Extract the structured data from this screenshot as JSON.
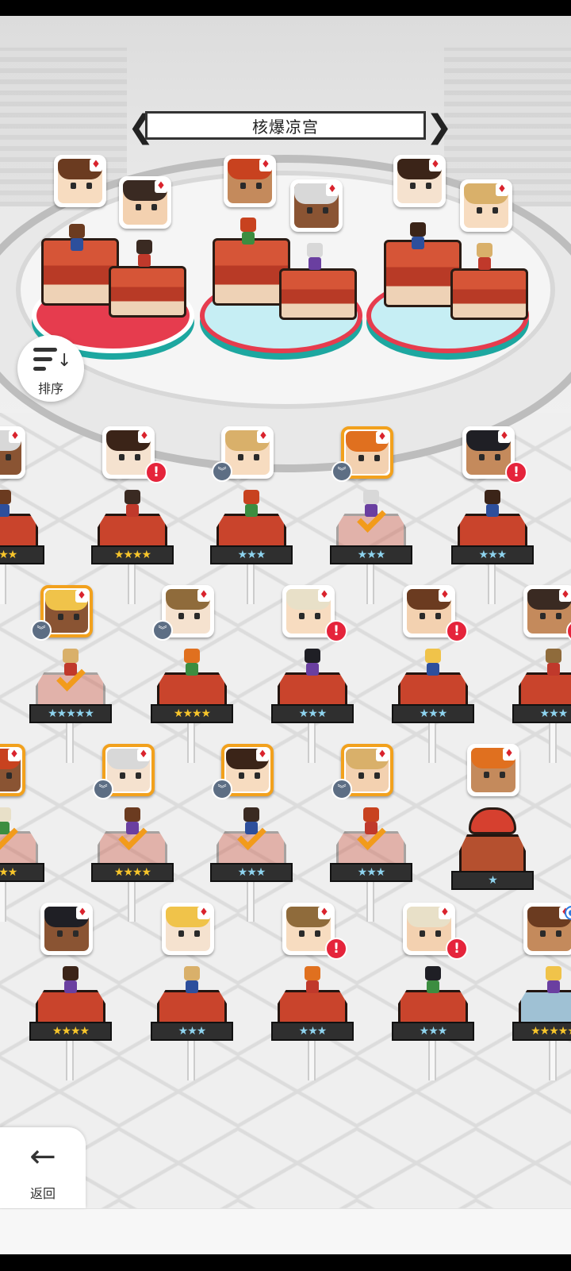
{
  "header": {
    "title": "核爆凉宫"
  },
  "controls": {
    "sort_label": "排序",
    "back_label": "返回"
  },
  "colors": {
    "accent_red": "#e63c4e",
    "teal": "#1da7a0",
    "selected_border": "#f2a11d",
    "alert": "#e5243b",
    "star_gold": "#f7c52b",
    "star_blue": "#8ed3ee"
  },
  "icons": {
    "sort": "sort-descending-icon",
    "back": "arrow-left-icon",
    "suit": "diamond-suit-icon",
    "alert": "exclamation-icon",
    "level": "rank-chevron-icon",
    "check": "checkmark-icon"
  },
  "suit_glyph": "♦",
  "alert_glyph": "!",
  "level_glyph": "︾",
  "star_glyph": "★",
  "team_slots": [
    {
      "slot": 1,
      "leader": "brown-hair girl",
      "member": "brown-hair boy"
    },
    {
      "slot": 2,
      "leader": "red-hair hero",
      "member": "white-hair warrior"
    },
    {
      "slot": 3,
      "leader": "spiky-hair boy",
      "member": "blonde-braid girl"
    }
  ],
  "roster": [
    {
      "row": 1,
      "col": 0,
      "stars": 3,
      "gold": true,
      "alert": false,
      "level": false,
      "selected": false,
      "partial": true
    },
    {
      "row": 1,
      "col": 1,
      "stars": 4,
      "gold": true,
      "alert": true,
      "level": false,
      "selected": false
    },
    {
      "row": 1,
      "col": 2,
      "stars": 3,
      "gold": false,
      "alert": false,
      "level": true,
      "selected": false
    },
    {
      "row": 1,
      "col": 3,
      "stars": 3,
      "gold": false,
      "alert": false,
      "level": true,
      "selected": true,
      "in_team": true
    },
    {
      "row": 1,
      "col": 4,
      "stars": 3,
      "gold": false,
      "alert": true,
      "level": false,
      "selected": false
    },
    {
      "row": 2,
      "col": 0,
      "stars": 5,
      "gold": false,
      "alert": false,
      "level": true,
      "selected": true,
      "in_team": true
    },
    {
      "row": 2,
      "col": 1,
      "stars": 4,
      "gold": true,
      "alert": false,
      "level": true,
      "selected": false
    },
    {
      "row": 2,
      "col": 2,
      "stars": 3,
      "gold": false,
      "alert": true,
      "level": false,
      "selected": false
    },
    {
      "row": 2,
      "col": 3,
      "stars": 3,
      "gold": false,
      "alert": true,
      "level": false,
      "selected": false
    },
    {
      "row": 2,
      "col": 4,
      "stars": 3,
      "gold": false,
      "alert": true,
      "level": false,
      "selected": false
    },
    {
      "row": 3,
      "col": 0,
      "stars": 3,
      "gold": true,
      "alert": false,
      "level": false,
      "selected": true,
      "in_team": true,
      "partial": true
    },
    {
      "row": 3,
      "col": 1,
      "stars": 4,
      "gold": true,
      "alert": false,
      "level": true,
      "selected": true,
      "in_team": true
    },
    {
      "row": 3,
      "col": 2,
      "stars": 3,
      "gold": false,
      "alert": false,
      "level": true,
      "selected": true,
      "in_team": true
    },
    {
      "row": 3,
      "col": 3,
      "stars": 3,
      "gold": false,
      "alert": false,
      "level": true,
      "selected": true,
      "in_team": true
    },
    {
      "row": 3,
      "col": 4,
      "stars": 1,
      "gold": false,
      "alert": false,
      "level": false,
      "selected": false,
      "mushroom": true
    },
    {
      "row": 4,
      "col": 0,
      "stars": 4,
      "gold": true,
      "alert": false,
      "level": false,
      "selected": false
    },
    {
      "row": 4,
      "col": 1,
      "stars": 3,
      "gold": false,
      "alert": false,
      "level": false,
      "selected": false
    },
    {
      "row": 4,
      "col": 2,
      "stars": 3,
      "gold": false,
      "alert": true,
      "level": false,
      "selected": false
    },
    {
      "row": 4,
      "col": 3,
      "stars": 3,
      "gold": false,
      "alert": true,
      "level": false,
      "selected": false
    },
    {
      "row": 4,
      "col": 4,
      "stars": 5,
      "gold": true,
      "alert": false,
      "level": false,
      "selected": false,
      "blue_base": true,
      "new_dot": true
    }
  ]
}
